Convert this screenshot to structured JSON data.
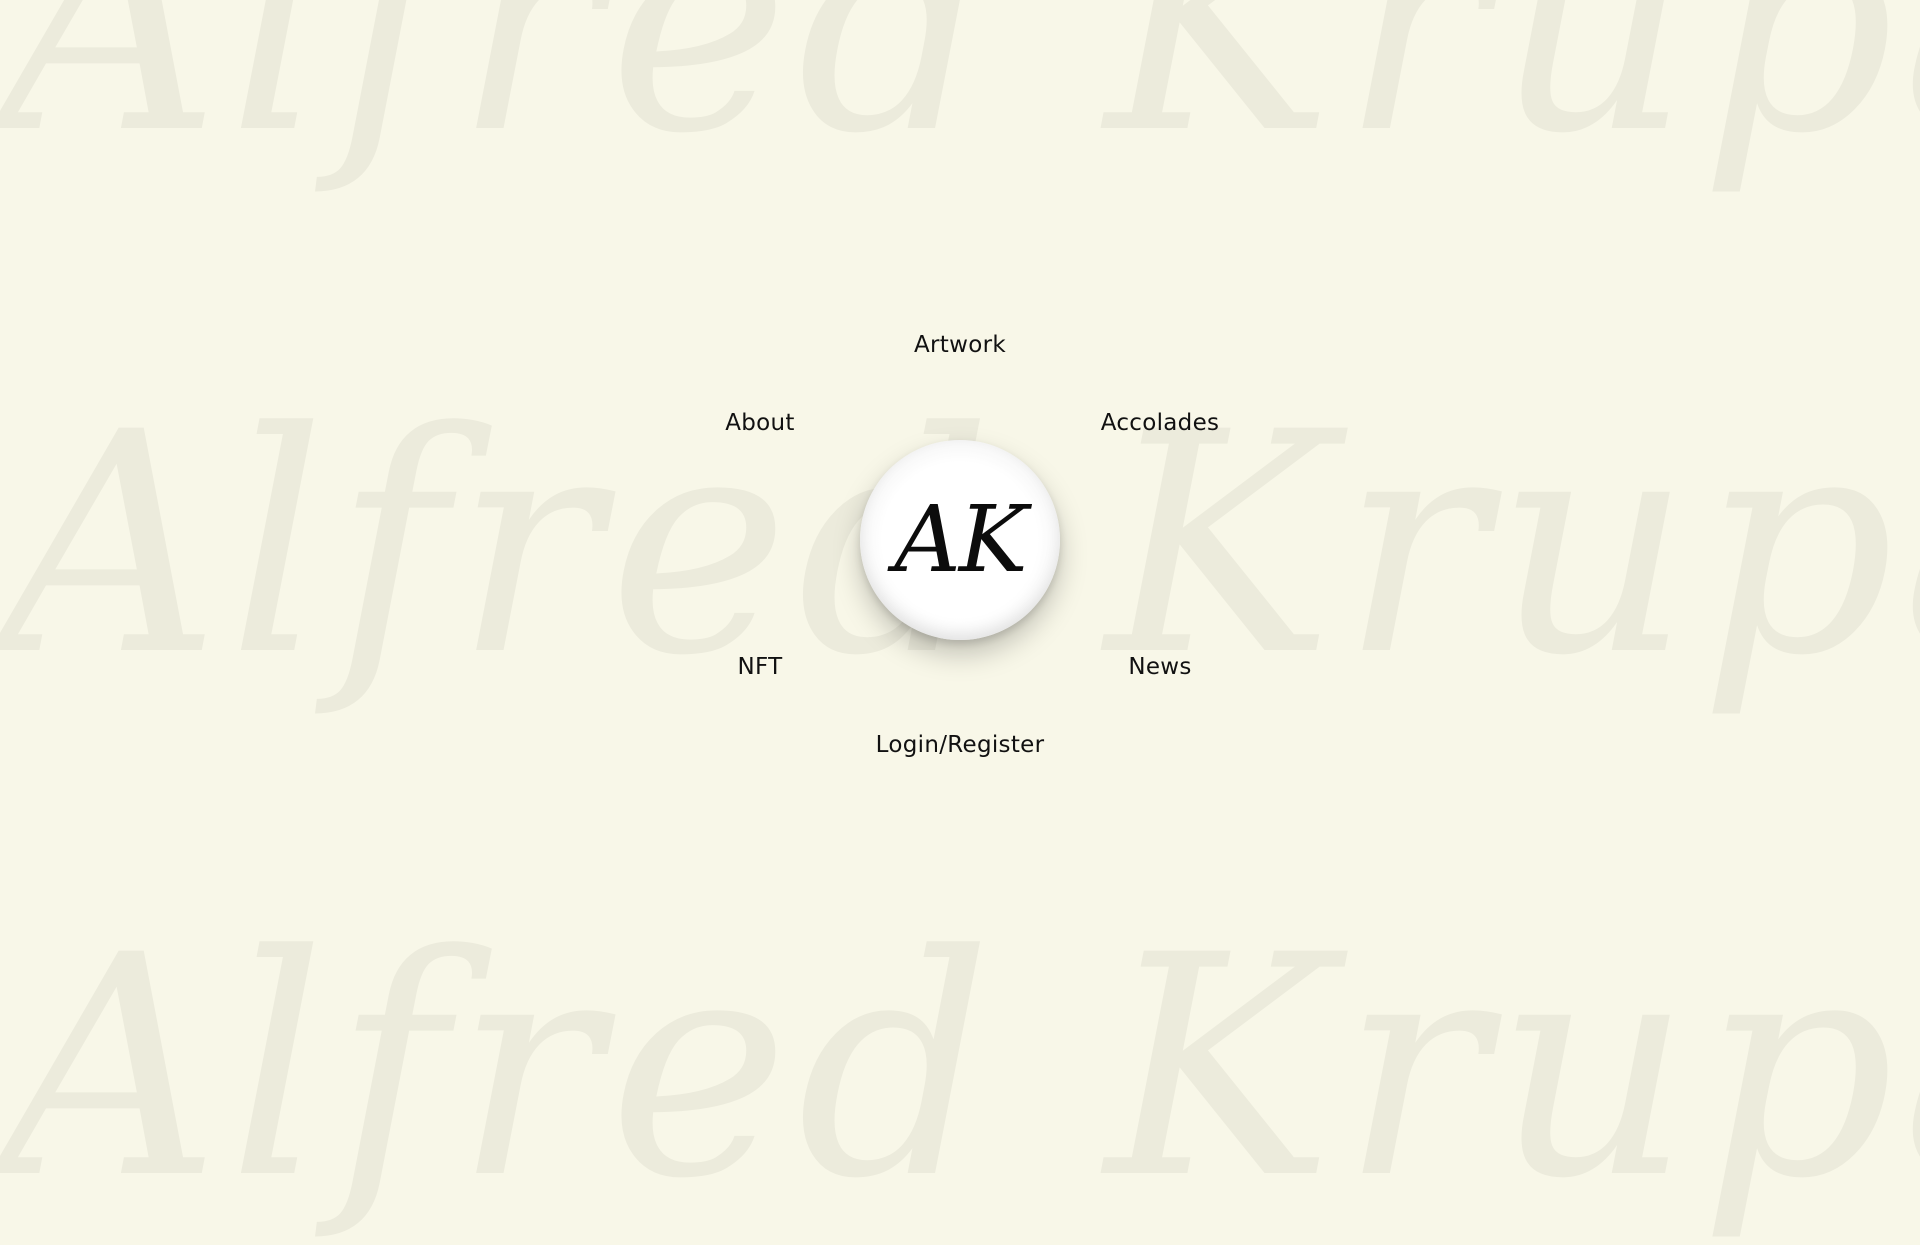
{
  "background": {
    "watermark_text": "Alfred Krupa",
    "color": "#ecebdc",
    "page_color": "#f8f7e8"
  },
  "logo": {
    "monogram": "AK"
  },
  "menu": {
    "artwork": "Artwork",
    "about": "About",
    "accolades": "Accolades",
    "nft": "NFT",
    "news": "News",
    "login_register": "Login/Register"
  }
}
